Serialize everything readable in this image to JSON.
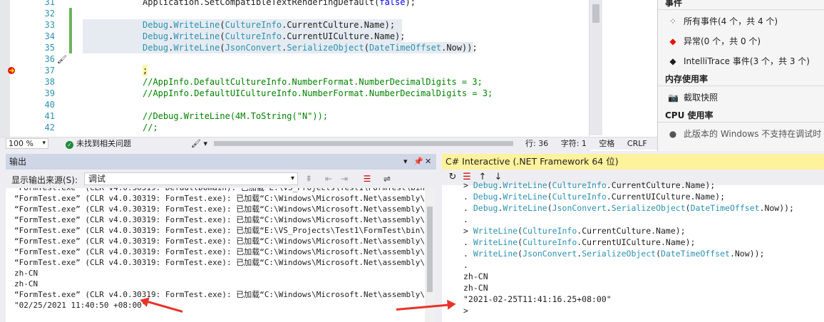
{
  "editor": {
    "lines": [
      {
        "num": "31",
        "code": [
          [
            "m",
            "Application.SetCompatibleTextRenderingDefault("
          ],
          [
            "kw",
            "false"
          ],
          [
            "m",
            ");"
          ]
        ],
        "changed": false,
        "highlight": false
      },
      {
        "num": "32",
        "code": [],
        "changed": true,
        "highlight": false
      },
      {
        "num": "33",
        "code": [
          [
            "k",
            "Debug"
          ],
          [
            "m",
            "."
          ],
          [
            "k",
            "WriteLine"
          ],
          [
            "m",
            "("
          ],
          [
            "k",
            "CultureInfo"
          ],
          [
            "m",
            ".CurrentCulture.Name);"
          ]
        ],
        "changed": true,
        "highlight": true
      },
      {
        "num": "34",
        "code": [
          [
            "k",
            "Debug"
          ],
          [
            "m",
            "."
          ],
          [
            "k",
            "WriteLine"
          ],
          [
            "m",
            "("
          ],
          [
            "k",
            "CultureInfo"
          ],
          [
            "m",
            ".CurrentUICulture.Name);"
          ]
        ],
        "changed": true,
        "highlight": true
      },
      {
        "num": "35",
        "code": [
          [
            "k",
            "Debug"
          ],
          [
            "m",
            "."
          ],
          [
            "k",
            "WriteLine"
          ],
          [
            "m",
            "("
          ],
          [
            "k",
            "JsonConvert"
          ],
          [
            "m",
            "."
          ],
          [
            "k",
            "SerializeObject"
          ],
          [
            "m",
            "("
          ],
          [
            "k",
            "DateTimeOffset"
          ],
          [
            "m",
            ".Now));"
          ]
        ],
        "changed": true,
        "highlight": true
      },
      {
        "num": "36",
        "code": [],
        "changed": false,
        "highlight": false,
        "brush": true
      },
      {
        "num": "37",
        "code": [
          [
            "m",
            ";"
          ]
        ],
        "changed": false,
        "highlight": false,
        "breakpoint": true
      },
      {
        "num": "38",
        "code": [
          [
            "cm",
            "//AppInfo.DefaultCultureInfo.NumberFormat.NumberDecimalDigits = 3;"
          ]
        ],
        "changed": false,
        "highlight": false
      },
      {
        "num": "39",
        "code": [
          [
            "cm",
            "//AppInfo.DefaultUICultureInfo.NumberFormat.NumberDecimalDigits = 3;"
          ]
        ],
        "changed": false,
        "highlight": false
      },
      {
        "num": "40",
        "code": [],
        "changed": false,
        "highlight": false
      },
      {
        "num": "41",
        "code": [
          [
            "cm",
            "//Debug.WriteLine(4M.ToString(\"N\"));"
          ]
        ],
        "changed": false,
        "highlight": false
      },
      {
        "num": "42",
        "code": [
          [
            "cm",
            "//;"
          ]
        ],
        "changed": false,
        "highlight": false
      }
    ]
  },
  "status": {
    "zoom": "100 %",
    "issues": "未找到相关问题",
    "line": "行: 36",
    "char": "字符: 1",
    "whitespace": "空格",
    "eol": "CRLF"
  },
  "diagnostics": {
    "events_header": "事件",
    "all_events": "所有事件(4 个，共 4 个)",
    "exceptions": "异常(0 个，共 0 个)",
    "intellitrace": "IntelliTrace 事件(3 个，共 3 个)",
    "memory_header": "内存使用率",
    "snapshot": "截取快照",
    "cpu_header": "CPU 使用率",
    "cpu_note": "此版本的 Windows 不支持在调试时"
  },
  "output": {
    "title": "输出",
    "source_label": "显示输出来源(S):",
    "source_value": "调试",
    "lines": [
      "“FormTest.exe” (CLR v4.0.30319: DefaultDomain): 已加载“E:\\VS_Projects\\Test1\\FormTest\\bin\\Debug",
      "“FormTest.exe” (CLR v4.0.30319: FormTest.exe): 已加载“C:\\Windows\\Microsoft.Net\\assembly\\GAC_M",
      "“FormTest.exe” (CLR v4.0.30319: FormTest.exe): 已加载“C:\\Windows\\Microsoft.Net\\assembly\\GAC_M",
      "“FormTest.exe” (CLR v4.0.30319: FormTest.exe): 已加载“C:\\Windows\\Microsoft.Net\\assembly\\GAC_M",
      "“FormTest.exe” (CLR v4.0.30319: FormTest.exe): 已加载“E:\\VS_Projects\\Test1\\FormTest\\bin\\Debug",
      "“FormTest.exe” (CLR v4.0.30319: FormTest.exe): 已加载“C:\\Windows\\Microsoft.Net\\assembly\\GAC_M",
      "“FormTest.exe” (CLR v4.0.30319: FormTest.exe): 已加载“C:\\Windows\\Microsoft.Net\\assembly\\GAC_M",
      "“FormTest.exe” (CLR v4.0.30319: FormTest.exe): 已加载“C:\\Windows\\Microsoft.Net\\assembly\\GAC_M",
      "zh-CN",
      "zh-CN",
      "“FormTest.exe” (CLR v4.0.30319: FormTest.exe): 已加载“C:\\Windows\\Microsoft.Net\\assembly\\GAC_3",
      "\"02/25/2021 11:40:50 +08:00\""
    ]
  },
  "interactive": {
    "title": "C# Interactive (.NET Framework 64 位)",
    "lines": [
      [
        [
          "m",
          "> "
        ],
        [
          "k",
          "Debug"
        ],
        [
          "m",
          "."
        ],
        [
          "k",
          "WriteLine"
        ],
        [
          "m",
          "("
        ],
        [
          "k",
          "CultureInfo"
        ],
        [
          "m",
          ".CurrentCulture.Name);"
        ]
      ],
      [
        [
          "m",
          ". "
        ],
        [
          "k",
          "Debug"
        ],
        [
          "m",
          "."
        ],
        [
          "k",
          "WriteLine"
        ],
        [
          "m",
          "("
        ],
        [
          "k",
          "CultureInfo"
        ],
        [
          "m",
          ".CurrentUICulture.Name);"
        ]
      ],
      [
        [
          "m",
          ". "
        ],
        [
          "k",
          "Debug"
        ],
        [
          "m",
          "."
        ],
        [
          "k",
          "WriteLine"
        ],
        [
          "m",
          "("
        ],
        [
          "k",
          "JsonConvert"
        ],
        [
          "m",
          "."
        ],
        [
          "k",
          "SerializeObject"
        ],
        [
          "m",
          "("
        ],
        [
          "k",
          "DateTimeOffset"
        ],
        [
          "m",
          ".Now));"
        ]
      ],
      [
        [
          "m",
          "."
        ]
      ],
      [
        [
          "m",
          "> "
        ],
        [
          "k",
          "WriteLine"
        ],
        [
          "m",
          "("
        ],
        [
          "k",
          "CultureInfo"
        ],
        [
          "m",
          ".CurrentCulture.Name);"
        ]
      ],
      [
        [
          "m",
          ". "
        ],
        [
          "k",
          "WriteLine"
        ],
        [
          "m",
          "("
        ],
        [
          "k",
          "CultureInfo"
        ],
        [
          "m",
          ".CurrentUICulture.Name);"
        ]
      ],
      [
        [
          "m",
          ". "
        ],
        [
          "k",
          "WriteLine"
        ],
        [
          "m",
          "("
        ],
        [
          "k",
          "JsonConvert"
        ],
        [
          "m",
          "."
        ],
        [
          "k",
          "SerializeObject"
        ],
        [
          "m",
          "("
        ],
        [
          "k",
          "DateTimeOffset"
        ],
        [
          "m",
          ".Now));"
        ]
      ],
      [
        [
          "m",
          "."
        ]
      ],
      [
        [
          "m",
          "zh-CN"
        ]
      ],
      [
        [
          "m",
          "zh-CN"
        ]
      ],
      [
        [
          "m",
          "\"2021-02-25T11:41:16.25+08:00\""
        ]
      ],
      [
        [
          "m",
          ">"
        ]
      ]
    ]
  },
  "colors": {
    "annotation_arrow": "#e8322a",
    "interactive_title_bg": "#fff29d",
    "output_title_bg": "#cfd6e5"
  }
}
